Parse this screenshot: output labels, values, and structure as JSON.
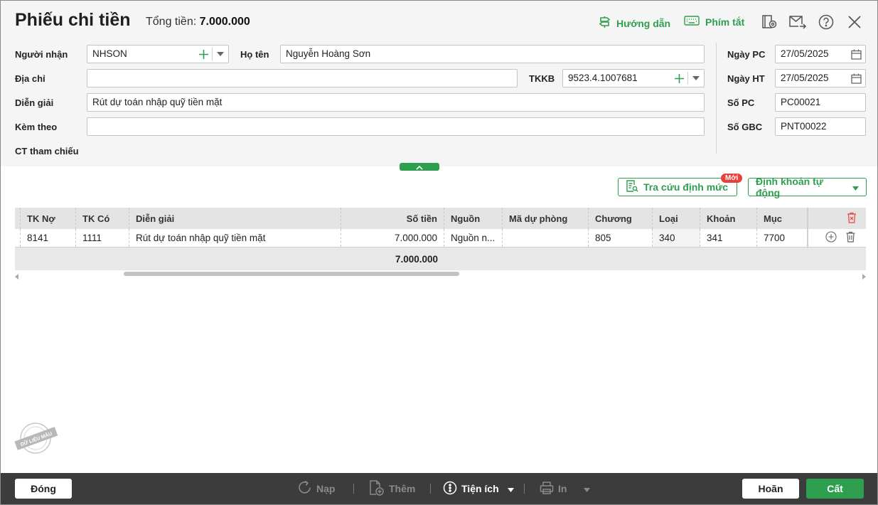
{
  "header": {
    "title": "Phiếu chi tiền",
    "total_label": "Tổng tiền:",
    "total_value": "7.000.000",
    "guide_label": "Hướng dẫn",
    "shortcut_label": "Phím tắt"
  },
  "form": {
    "recipient_label": "Người nhận",
    "recipient_value": "NHSON",
    "fullname_label": "Họ tên",
    "fullname_value": "Nguyễn Hoàng Sơn",
    "address_label": "Địa chỉ",
    "address_value": "",
    "tkkb_label": "TKKB",
    "tkkb_value": "9523.4.1007681",
    "description_label": "Diễn giải",
    "description_value": "Rút dự toán nhập quỹ tiền mặt",
    "attach_label": "Kèm theo",
    "attach_value": "",
    "reference_label": "CT tham chiếu",
    "date_pc_label": "Ngày PC",
    "date_pc_value": "27/05/2025",
    "date_ht_label": "Ngày HT",
    "date_ht_value": "27/05/2025",
    "no_pc_label": "Số PC",
    "no_pc_value": "PC00021",
    "no_gbc_label": "Số GBC",
    "no_gbc_value": "PNT00022"
  },
  "actions": {
    "lookup_label": "Tra cứu định mức",
    "new_badge": "Mới",
    "auto_label": "Định khoản tự động"
  },
  "table": {
    "columns": [
      "TK Nợ",
      "TK Có",
      "Diễn giải",
      "Số tiền",
      "Nguồn",
      "Mã dự phòng",
      "Chương",
      "Loại",
      "Khoản",
      "Mục"
    ],
    "rows": [
      [
        "8141",
        "1111",
        "Rút dự toán nhập quỹ tiền mặt",
        "7.000.000",
        "Nguồn n...",
        "",
        "805",
        "340",
        "341",
        "7700"
      ]
    ],
    "total": "7.000.000"
  },
  "watermark": "DỮ LIỆU MẪU",
  "footer": {
    "close_label": "Đóng",
    "reload_label": "Nạp",
    "add_label": "Thêm",
    "utility_label": "Tiện ích",
    "print_label": "In",
    "undo_label": "Hoãn",
    "save_label": "Cất"
  },
  "colors": {
    "accent": "#2e9e4f",
    "badge": "#e8413c",
    "footer_bg": "#3c3c3c",
    "header_bg": "#f5f5f5"
  }
}
